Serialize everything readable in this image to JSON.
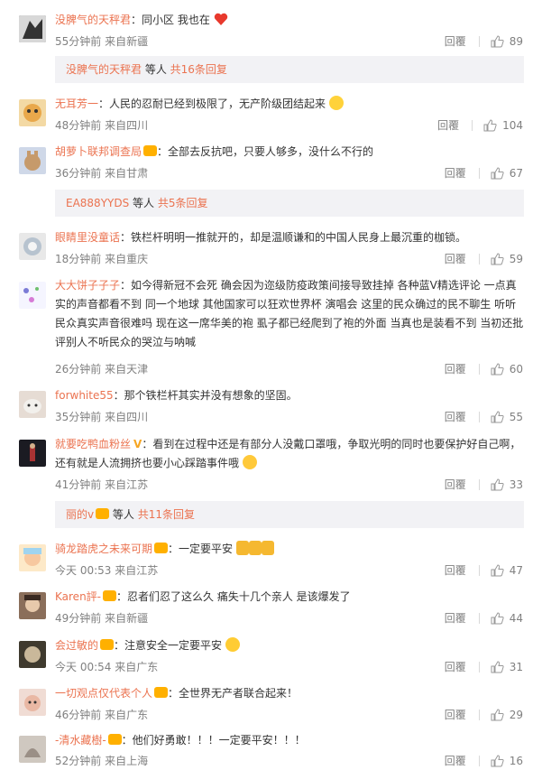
{
  "comments": [
    {
      "user": "没脾气的天秤君",
      "text": "：同小区 我也在",
      "emoji": "heart",
      "time": "55分钟前",
      "loc": "来自新疆",
      "reply": "回覆",
      "likes": "89"
    },
    {
      "user": "无耳芳一",
      "text": "：人民的忍耐已经到极限了，无产阶级团结起来",
      "emoji": "cry",
      "time": "48分钟前",
      "loc": "来自四川",
      "reply": "回覆",
      "likes": "104"
    },
    {
      "user": "胡萝卜联邦调查局",
      "text": "：全部去反抗吧，只要人够多，没什么不行的",
      "time": "36分钟前",
      "loc": "来自甘肃",
      "reply": "回覆",
      "likes": "67"
    },
    {
      "user": "眼睛里没童话",
      "text": "：铁栏杆明明一推就开的，却是温顺谦和的中国人民身上最沉重的枷锁。",
      "time": "18分钟前",
      "loc": "来自重庆",
      "reply": "回覆",
      "likes": "59"
    },
    {
      "user": "大大饼子子子",
      "text": "：如今得新冠不会死 确会因为迩级防疫政策间接导致挂掉 各种蓝V精选评论 一点真实的声音都看不到 同一个地球 其他国家可以狂欢世界杯 演唱会 这里的民众确过的民不聊生 听听民众真实声音很难吗 现在这一席华美的袍 虱子都已经爬到了袍的外面 当真也是装看不到 当初还批评别人不听民众的哭泣与呐喊",
      "time": "26分钟前",
      "loc": "来自天津",
      "reply": "回覆",
      "likes": "60"
    },
    {
      "user": "forwhite55",
      "text": "：那个铁栏杆其实并没有想象的坚固。",
      "time": "35分钟前",
      "loc": "来自四川",
      "reply": "回覆",
      "likes": "55"
    },
    {
      "user": "就要吃鸭血粉丝",
      "vbadge": "V",
      "text": "：看到在过程中还是有部分人没戴口罩哦，争取光明的同时也要保护好自己啊，还有就是人流拥挤也要小心踩踏事件哦",
      "emoji": "kiss",
      "time": "41分钟前",
      "loc": "来自江苏",
      "reply": "回覆",
      "likes": "33"
    },
    {
      "user": "骑龙踏虎之未来可期",
      "text": "：一定要平安",
      "emoji": "pray",
      "time": "今天 00:53",
      "loc": "来自江苏",
      "reply": "回覆",
      "likes": "47"
    },
    {
      "user": "Karen評-",
      "text": "：忍者们忍了这么久 痛失十几个亲人 是该爆发了",
      "time": "49分钟前",
      "loc": "来自新疆",
      "reply": "回覆",
      "likes": "44"
    },
    {
      "user": "会过敏的",
      "text": "：注意安全一定要平安",
      "emoji": "hug",
      "time": "今天 00:54",
      "loc": "来自广东",
      "reply": "回覆",
      "likes": "31"
    },
    {
      "user": "一切观点仅代表个人",
      "text": "：全世界无产者联合起来！",
      "time": "46分钟前",
      "loc": "来自广东",
      "reply": "回覆",
      "likes": "29"
    },
    {
      "user": "-清水藏樹-",
      "text": "：他们好勇敢！！！一定要平安！！！",
      "time": "52分钟前",
      "loc": "来自上海",
      "reply": "回覆",
      "likes": "16"
    }
  ],
  "subreplies": [
    {
      "user": "没脾气的天秤君",
      "mid": " 等人 ",
      "more": "共16条回复"
    },
    {
      "user": "EA888YYDS",
      "mid": " 等人 ",
      "more": "共5条回复"
    },
    {
      "user": "丽的v",
      "mid": " 等人 ",
      "more": "共11条回复"
    }
  ],
  "colors": {
    "username": "#eb7350",
    "meta": "#808080",
    "subreply_bg": "#f2f2f5"
  }
}
